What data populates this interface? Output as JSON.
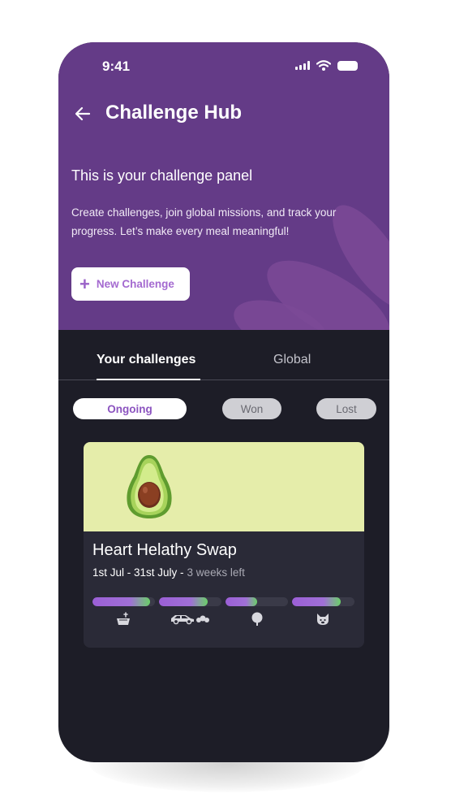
{
  "status_bar": {
    "time": "9:41",
    "icons": [
      "signal-icon",
      "wifi-icon",
      "battery-icon"
    ]
  },
  "header": {
    "title": "Challenge Hub",
    "back_icon": "arrow-left-icon",
    "panel_heading": "This is your challenge panel",
    "panel_description": "Create challenges, join global missions, and track your progress. Let’s make every meal meaningful!",
    "new_challenge_label": "New Challenge",
    "new_challenge_icon": "plus-icon"
  },
  "tabs": [
    {
      "label": "Your challenges",
      "active": true
    },
    {
      "label": "Global",
      "active": false
    }
  ],
  "filters": [
    {
      "label": "Ongoing",
      "selected": true
    },
    {
      "label": "Won",
      "selected": false
    },
    {
      "label": "Lost",
      "selected": false
    }
  ],
  "challenge_card": {
    "image": "avocado-illustration",
    "title": "Heart Helathy Swap",
    "date_range": "1st Jul - 31st July -",
    "time_left": "3 weeks left",
    "progress": [
      {
        "category": "water-icon",
        "value": 0.92
      },
      {
        "category": "car-icon",
        "value": 0.78
      },
      {
        "category": "tree-icon",
        "value": 0.5
      },
      {
        "category": "animal-icon",
        "value": 0.78
      }
    ]
  },
  "colors": {
    "header_bg": "#643b87",
    "app_bg": "#1d1d27",
    "card_bg": "#2a2a37",
    "card_image_bg": "#e5edaa",
    "accent_purple": "#9b5fd6",
    "accent_green": "#6ad068"
  }
}
